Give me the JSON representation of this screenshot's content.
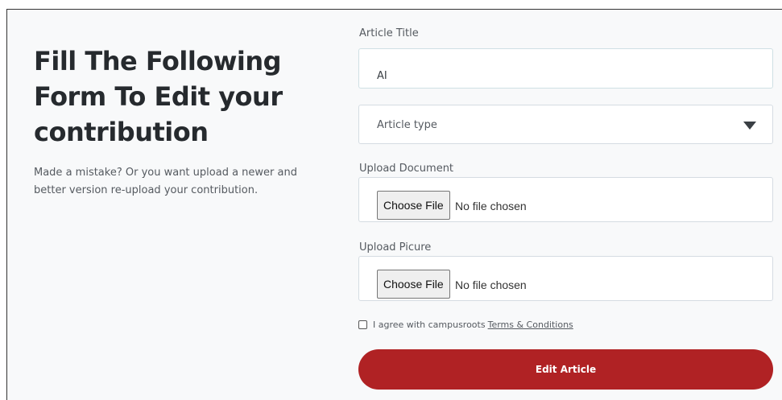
{
  "intro": {
    "title": "Fill The Following Form To Edit your contribution",
    "description": "Made a mistake? Or you want upload a newer and better version re-upload your contribution."
  },
  "form": {
    "title_label": "Article Title",
    "title_value": "AI",
    "type_placeholder": "Article type",
    "document_label": "Upload Document",
    "picture_label": "Upload Picure",
    "choose_file_label": "Choose File",
    "no_file_text": "No file chosen",
    "agree_text": "I agree with campusroots",
    "terms_link": "Terms & Conditions",
    "submit_label": "Edit Article"
  },
  "colors": {
    "accent": "#b02224",
    "background": "#f8f9fa"
  },
  "icons": {
    "select": "caret-down-icon"
  }
}
